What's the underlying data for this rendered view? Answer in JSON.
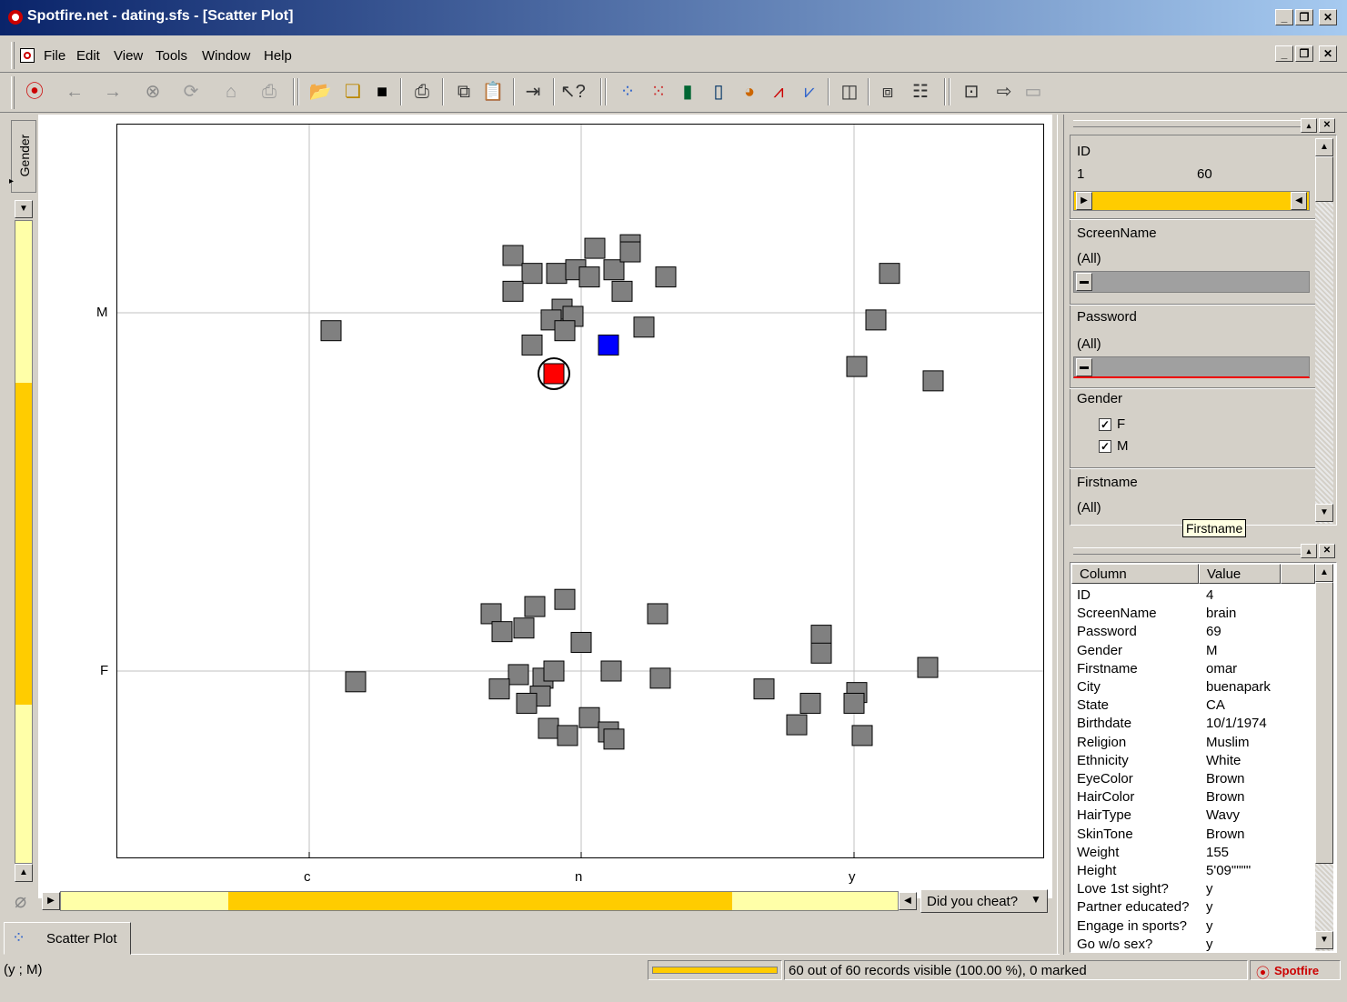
{
  "window": {
    "title": "Spotfire.net - dating.sfs - [Scatter Plot]"
  },
  "menu": [
    "File",
    "Edit",
    "View",
    "Tools",
    "Window",
    "Help"
  ],
  "toolbar_icons": [
    "spotfire-icon",
    "back-icon",
    "forward-icon",
    "stop-icon",
    "refresh-icon",
    "home-icon",
    "print-icon",
    "open-icon",
    "copy-icon",
    "save-icon",
    "print2-icon",
    "copy2-icon",
    "paste-icon",
    "import-icon",
    "help-icon",
    "scatter-icon",
    "scatter3d-icon",
    "bar-icon",
    "histogram-icon",
    "pie-icon",
    "line-icon",
    "profile-icon",
    "table-icon",
    "properties-icon",
    "list-icon",
    "export-icon",
    "export2-icon",
    "window-icon"
  ],
  "yaxis": {
    "label": "Gender",
    "ticks": [
      "M",
      "F"
    ]
  },
  "xaxis": {
    "label": "Did you cheat?",
    "ticks": [
      "c",
      "n",
      "y"
    ]
  },
  "query_panel": {
    "id_label": "ID",
    "id_min": "1",
    "id_max": "60",
    "screenname_label": "ScreenName",
    "screenname_value": "(All)",
    "password_label": "Password",
    "password_value": "(All)",
    "gender_label": "Gender",
    "gender_options": [
      "F",
      "M"
    ],
    "firstname_label": "Firstname",
    "firstname_value": "(All)",
    "tooltip": "Firstname"
  },
  "details": {
    "col_header": "Column",
    "val_header": "Value",
    "rows": [
      [
        "ID",
        "4"
      ],
      [
        "ScreenName",
        "brain"
      ],
      [
        "Password",
        "69"
      ],
      [
        "Gender",
        "M"
      ],
      [
        "Firstname",
        "omar"
      ],
      [
        "City",
        "buenapark"
      ],
      [
        "State",
        "CA"
      ],
      [
        "Birthdate",
        "10/1/1974"
      ],
      [
        "Religion",
        "Muslim"
      ],
      [
        "Ethnicity",
        "White"
      ],
      [
        "EyeColor",
        "Brown"
      ],
      [
        "HairColor",
        "Brown"
      ],
      [
        "HairType",
        "Wavy"
      ],
      [
        "SkinTone",
        "Brown"
      ],
      [
        "Weight",
        "155"
      ],
      [
        "Height",
        "5'09\"\"\"\""
      ],
      [
        "Love 1st sight?",
        "y"
      ],
      [
        "Partner educated?",
        "y"
      ],
      [
        "Engage in sports?",
        "y"
      ],
      [
        "Go w/o sex?",
        "y"
      ]
    ]
  },
  "tab": "Scatter Plot",
  "status": {
    "coords": "(y ; M)",
    "records": "60 out of 60 records visible (100.00 %), 0 marked",
    "logo": "Spotfire"
  },
  "colors": {
    "marker": "#808080",
    "marked": "#ff0000",
    "active": "#0000ff",
    "slider": "#ffcc00"
  },
  "chart_data": {
    "type": "scatter",
    "xlabel": "Did you cheat?",
    "ylabel": "Gender",
    "x_categories": [
      "c",
      "n",
      "y"
    ],
    "y_categories": [
      "F",
      "M"
    ],
    "points": [
      {
        "x": "c",
        "y": "M",
        "dx": 0.08,
        "dy": -0.05
      },
      {
        "x": "n",
        "y": "M",
        "dx": -0.25,
        "dy": 0.16
      },
      {
        "x": "n",
        "y": "M",
        "dx": -0.18,
        "dy": 0.11
      },
      {
        "x": "n",
        "y": "M",
        "dx": -0.25,
        "dy": 0.06
      },
      {
        "x": "n",
        "y": "M",
        "dx": -0.09,
        "dy": 0.11
      },
      {
        "x": "n",
        "y": "M",
        "dx": -0.02,
        "dy": 0.12
      },
      {
        "x": "n",
        "y": "M",
        "dx": 0.05,
        "dy": 0.18
      },
      {
        "x": "n",
        "y": "M",
        "dx": 0.03,
        "dy": 0.1
      },
      {
        "x": "n",
        "y": "M",
        "dx": 0.12,
        "dy": 0.12
      },
      {
        "x": "n",
        "y": "M",
        "dx": 0.18,
        "dy": 0.19
      },
      {
        "x": "n",
        "y": "M",
        "dx": 0.18,
        "dy": 0.17
      },
      {
        "x": "n",
        "y": "M",
        "dx": 0.15,
        "dy": 0.06
      },
      {
        "x": "n",
        "y": "M",
        "dx": 0.31,
        "dy": 0.1
      },
      {
        "x": "n",
        "y": "M",
        "dx": -0.07,
        "dy": 0.01
      },
      {
        "x": "n",
        "y": "M",
        "dx": -0.11,
        "dy": -0.02
      },
      {
        "x": "n",
        "y": "M",
        "dx": -0.03,
        "dy": -0.01
      },
      {
        "x": "n",
        "y": "M",
        "dx": -0.06,
        "dy": -0.05
      },
      {
        "x": "n",
        "y": "M",
        "dx": -0.18,
        "dy": -0.09
      },
      {
        "x": "n",
        "y": "M",
        "dx": 0.23,
        "dy": -0.04
      },
      {
        "x": "y",
        "y": "M",
        "dx": 0.13,
        "dy": 0.11
      },
      {
        "x": "y",
        "y": "M",
        "dx": 0.08,
        "dy": -0.02
      },
      {
        "x": "y",
        "y": "M",
        "dx": 0.01,
        "dy": -0.15
      },
      {
        "x": "y",
        "y": "M",
        "dx": 0.29,
        "dy": -0.19
      },
      {
        "x": "n",
        "y": "F",
        "dx": -0.33,
        "dy": 0.16
      },
      {
        "x": "n",
        "y": "F",
        "dx": -0.17,
        "dy": 0.18
      },
      {
        "x": "n",
        "y": "F",
        "dx": -0.06,
        "dy": 0.2
      },
      {
        "x": "n",
        "y": "F",
        "dx": -0.29,
        "dy": 0.11
      },
      {
        "x": "n",
        "y": "F",
        "dx": -0.21,
        "dy": 0.12
      },
      {
        "x": "n",
        "y": "F",
        "dx": 0.28,
        "dy": 0.16
      },
      {
        "x": "n",
        "y": "F",
        "dx": 0.0,
        "dy": 0.08
      },
      {
        "x": "n",
        "y": "F",
        "dx": -0.23,
        "dy": -0.01
      },
      {
        "x": "n",
        "y": "F",
        "dx": -0.14,
        "dy": -0.02
      },
      {
        "x": "n",
        "y": "F",
        "dx": -0.1,
        "dy": 0.0
      },
      {
        "x": "n",
        "y": "F",
        "dx": 0.11,
        "dy": 0.0
      },
      {
        "x": "n",
        "y": "F",
        "dx": 0.29,
        "dy": -0.02
      },
      {
        "x": "n",
        "y": "F",
        "dx": -0.3,
        "dy": -0.05
      },
      {
        "x": "n",
        "y": "F",
        "dx": -0.15,
        "dy": -0.07
      },
      {
        "x": "n",
        "y": "F",
        "dx": -0.2,
        "dy": -0.09
      },
      {
        "x": "n",
        "y": "F",
        "dx": -0.12,
        "dy": -0.16
      },
      {
        "x": "n",
        "y": "F",
        "dx": -0.05,
        "dy": -0.18
      },
      {
        "x": "n",
        "y": "F",
        "dx": 0.03,
        "dy": -0.13
      },
      {
        "x": "n",
        "y": "F",
        "dx": 0.1,
        "dy": -0.17
      },
      {
        "x": "n",
        "y": "F",
        "dx": 0.12,
        "dy": -0.19
      },
      {
        "x": "y",
        "y": "F",
        "dx": -0.33,
        "dy": -0.05
      },
      {
        "x": "y",
        "y": "F",
        "dx": -0.12,
        "dy": 0.1
      },
      {
        "x": "y",
        "y": "F",
        "dx": -0.12,
        "dy": 0.05
      },
      {
        "x": "y",
        "y": "F",
        "dx": -0.16,
        "dy": -0.09
      },
      {
        "x": "y",
        "y": "F",
        "dx": -0.21,
        "dy": -0.15
      },
      {
        "x": "y",
        "y": "F",
        "dx": 0.01,
        "dy": -0.06
      },
      {
        "x": "y",
        "y": "F",
        "dx": 0.0,
        "dy": -0.09
      },
      {
        "x": "y",
        "y": "F",
        "dx": 0.03,
        "dy": -0.18
      },
      {
        "x": "y",
        "y": "F",
        "dx": 0.27,
        "dy": 0.01
      },
      {
        "x": "c",
        "y": "F",
        "dx": 0.17,
        "dy": -0.03
      }
    ],
    "marked_point": {
      "x": "n",
      "y": "M",
      "dx": -0.1,
      "dy": -0.17
    },
    "active_point": {
      "x": "n",
      "y": "M",
      "dx": 0.1,
      "dy": -0.09
    }
  }
}
